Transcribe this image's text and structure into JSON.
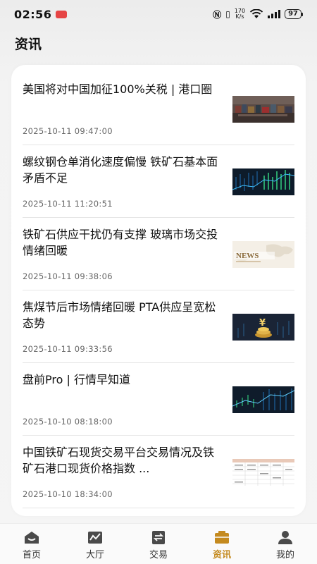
{
  "status_bar": {
    "time": "02:56",
    "speed_top": "170",
    "speed_bottom": "K/s",
    "battery": "97"
  },
  "header": {
    "title": "资讯"
  },
  "news": [
    {
      "title": "美国将对中国加征100%关税 | 港口圈",
      "time": "2025-10-11 09:47:00",
      "thumb_icon": "port-containers-thumbnail"
    },
    {
      "title": "螺纹钢仓单消化速度偏慢 铁矿石基本面矛盾不足",
      "time": "2025-10-11 11:20:51",
      "thumb_icon": "stock-chart-thumbnail"
    },
    {
      "title": "铁矿石供应干扰仍有支撑 玻璃市场交投情绪回暖",
      "time": "2025-10-11 09:38:06",
      "thumb_icon": "news-map-thumbnail"
    },
    {
      "title": "焦煤节后市场情绪回暖 PTA供应呈宽松态势",
      "time": "2025-10-11 09:33:56",
      "thumb_icon": "yuan-coins-thumbnail"
    },
    {
      "title": "盘前Pro | 行情早知道",
      "time": "2025-10-10 08:18:00",
      "thumb_icon": "stock-chart-thumbnail"
    },
    {
      "title": "中国铁矿石现货交易平台交易情况及铁矿石港口现货价格指数 ...",
      "time": "2025-10-10 18:34:00",
      "thumb_icon": "price-table-thumbnail"
    }
  ],
  "nav": {
    "items": [
      {
        "label": "首页",
        "icon": "home-icon"
      },
      {
        "label": "大厅",
        "icon": "hall-icon"
      },
      {
        "label": "交易",
        "icon": "trade-icon"
      },
      {
        "label": "资讯",
        "icon": "news-icon",
        "active": true
      },
      {
        "label": "我的",
        "icon": "profile-icon"
      }
    ]
  },
  "colors": {
    "accent": "#c48a1f",
    "card": "#ffffff",
    "background": "#f3f3f3"
  }
}
